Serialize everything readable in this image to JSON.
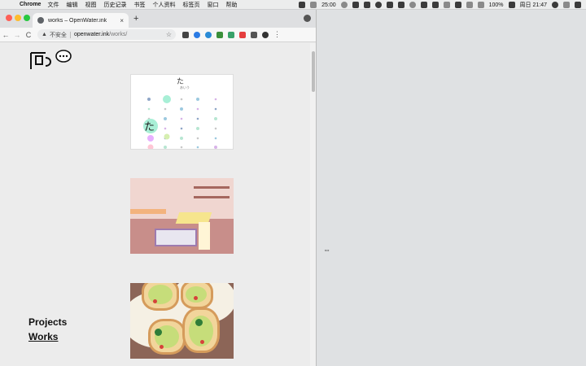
{
  "menubar": {
    "apple_glyph": "",
    "app_name": "Chrome",
    "items": [
      "文件",
      "编辑",
      "视图",
      "历史记录",
      "书签",
      "个人资料",
      "标签页",
      "窗口",
      "帮助"
    ],
    "timer": "25:00",
    "battery": "100%",
    "clock": "周日 21:47"
  },
  "browser": {
    "tab_title": "works – OpenWater.ink",
    "tab_close": "×",
    "new_tab": "+",
    "nav_back": "←",
    "nav_forward": "→",
    "nav_reload": "C",
    "security_label": "不安全",
    "url_host": "openwater.ink",
    "url_path": "/works/",
    "bookmark_star": "☆",
    "menu_dots": "⋮"
  },
  "page": {
    "nav_links": [
      "Projects",
      "Works"
    ],
    "artworks": [
      {
        "name": "artwork-hiragana-grid",
        "glyph": "た",
        "caption": "あいう"
      },
      {
        "name": "artwork-pink-room"
      },
      {
        "name": "artwork-avocado-toast"
      }
    ]
  },
  "colors": {
    "accent_close": "#fe5f57",
    "accent_min": "#febc2e",
    "accent_max": "#28c840"
  }
}
